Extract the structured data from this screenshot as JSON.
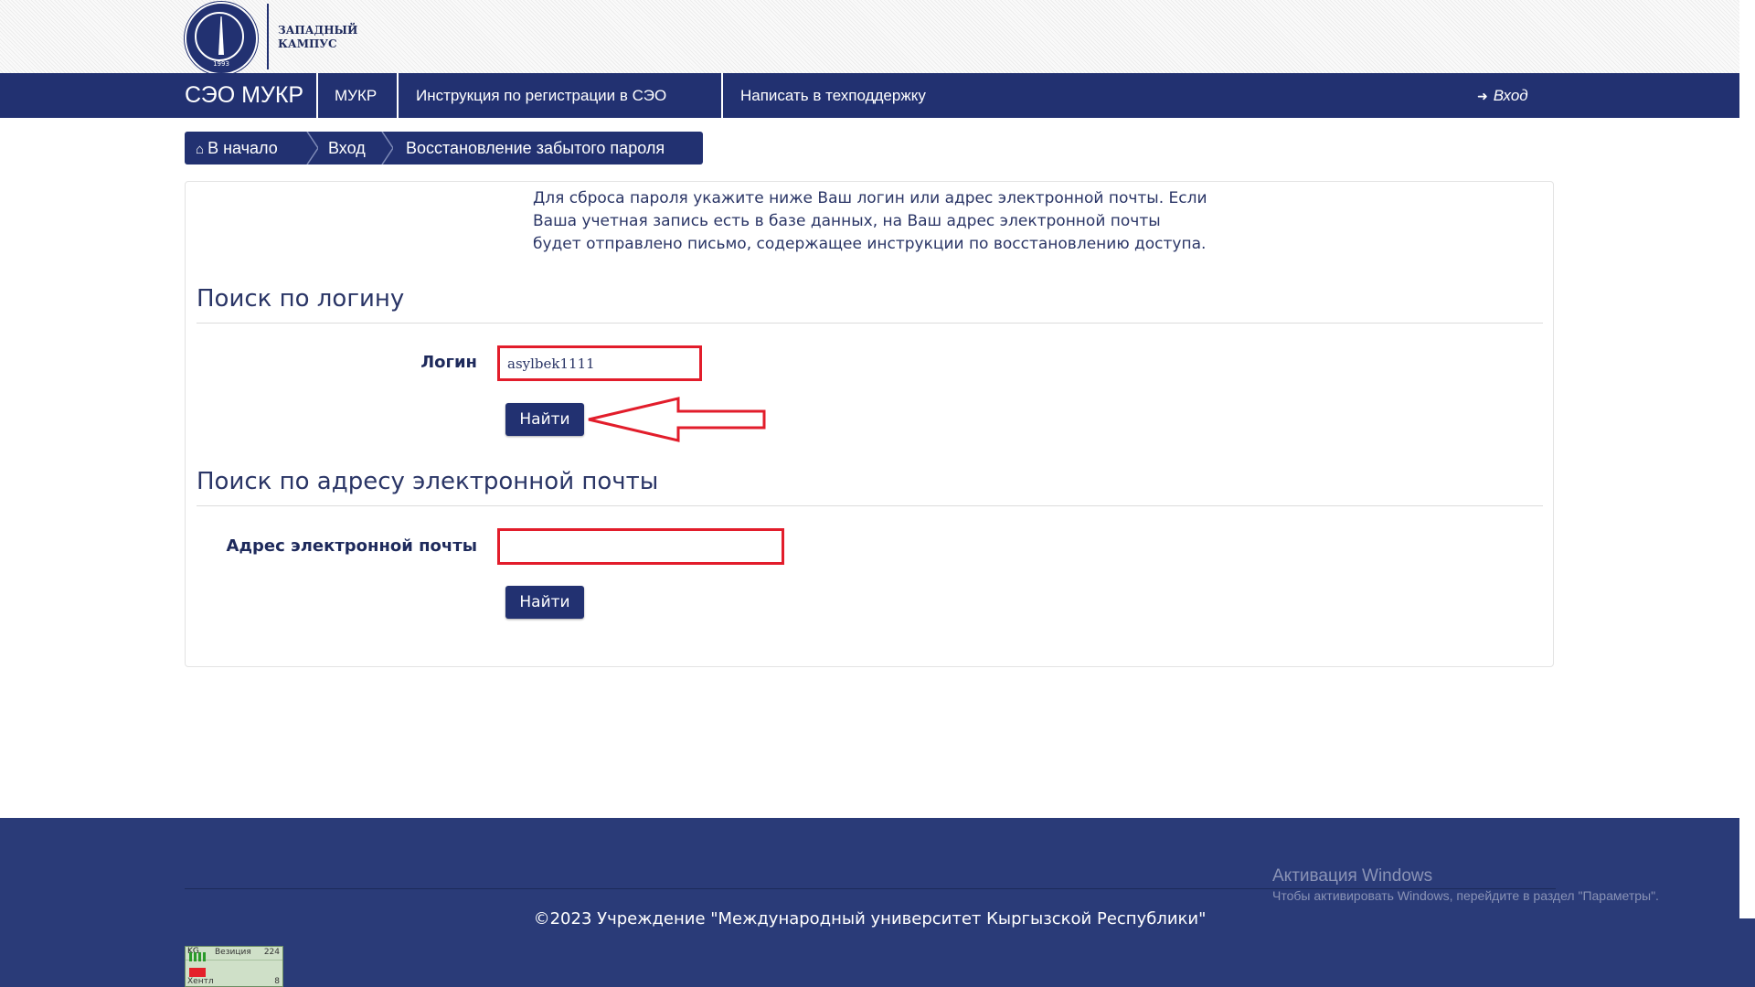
{
  "header": {
    "logo_year": "1993",
    "campus_line1": "ЗАПАДНЫЙ",
    "campus_line2": "КАМПУС"
  },
  "navbar": {
    "brand": "СЭО МУКР",
    "items": [
      {
        "label": "МУКР"
      },
      {
        "label": "Инструкция по регистрации в СЭО"
      },
      {
        "label": "Написать в техподдержку"
      }
    ],
    "login_label": "Вход",
    "login_icon": "sign-in-icon"
  },
  "breadcrumb": {
    "home_icon": "home-icon",
    "items": [
      {
        "label": "В начало"
      },
      {
        "label": "Вход"
      },
      {
        "label": "Восстановление забытого пароля"
      }
    ]
  },
  "intro_text": "Для сброса пароля укажите ниже Ваш логин или адрес электронной почты. Если Ваша учетная запись есть в базе данных, на Ваш адрес электронной почты будет отправлено письмо, содержащее инструкции по восстановлению доступа.",
  "search_by_login": {
    "title": "Поиск по логину",
    "field_label": "Логин",
    "field_value": "asylbek1111",
    "button_label": "Найти"
  },
  "search_by_email": {
    "title": "Поиск по адресу электронной почты",
    "field_label": "Адрес электронной почты",
    "field_value": "",
    "button_label": "Найти"
  },
  "footer": {
    "copyright": "©2023 Учреждение \"Международный университет Кыргызской Республики\""
  },
  "windows_activation": {
    "title": "Активация Windows",
    "subtitle": "Чтобы активировать Windows, перейдите в раздел \"Параметры\"."
  },
  "tray_widget": {
    "code": "KG",
    "row1_label": "Везиция",
    "row1_value": "224",
    "row2_label": "Хентл",
    "row2_value": "8"
  },
  "colors": {
    "primary": "#223171",
    "footer": "#2a3b78",
    "highlight": "#e21d2b"
  }
}
